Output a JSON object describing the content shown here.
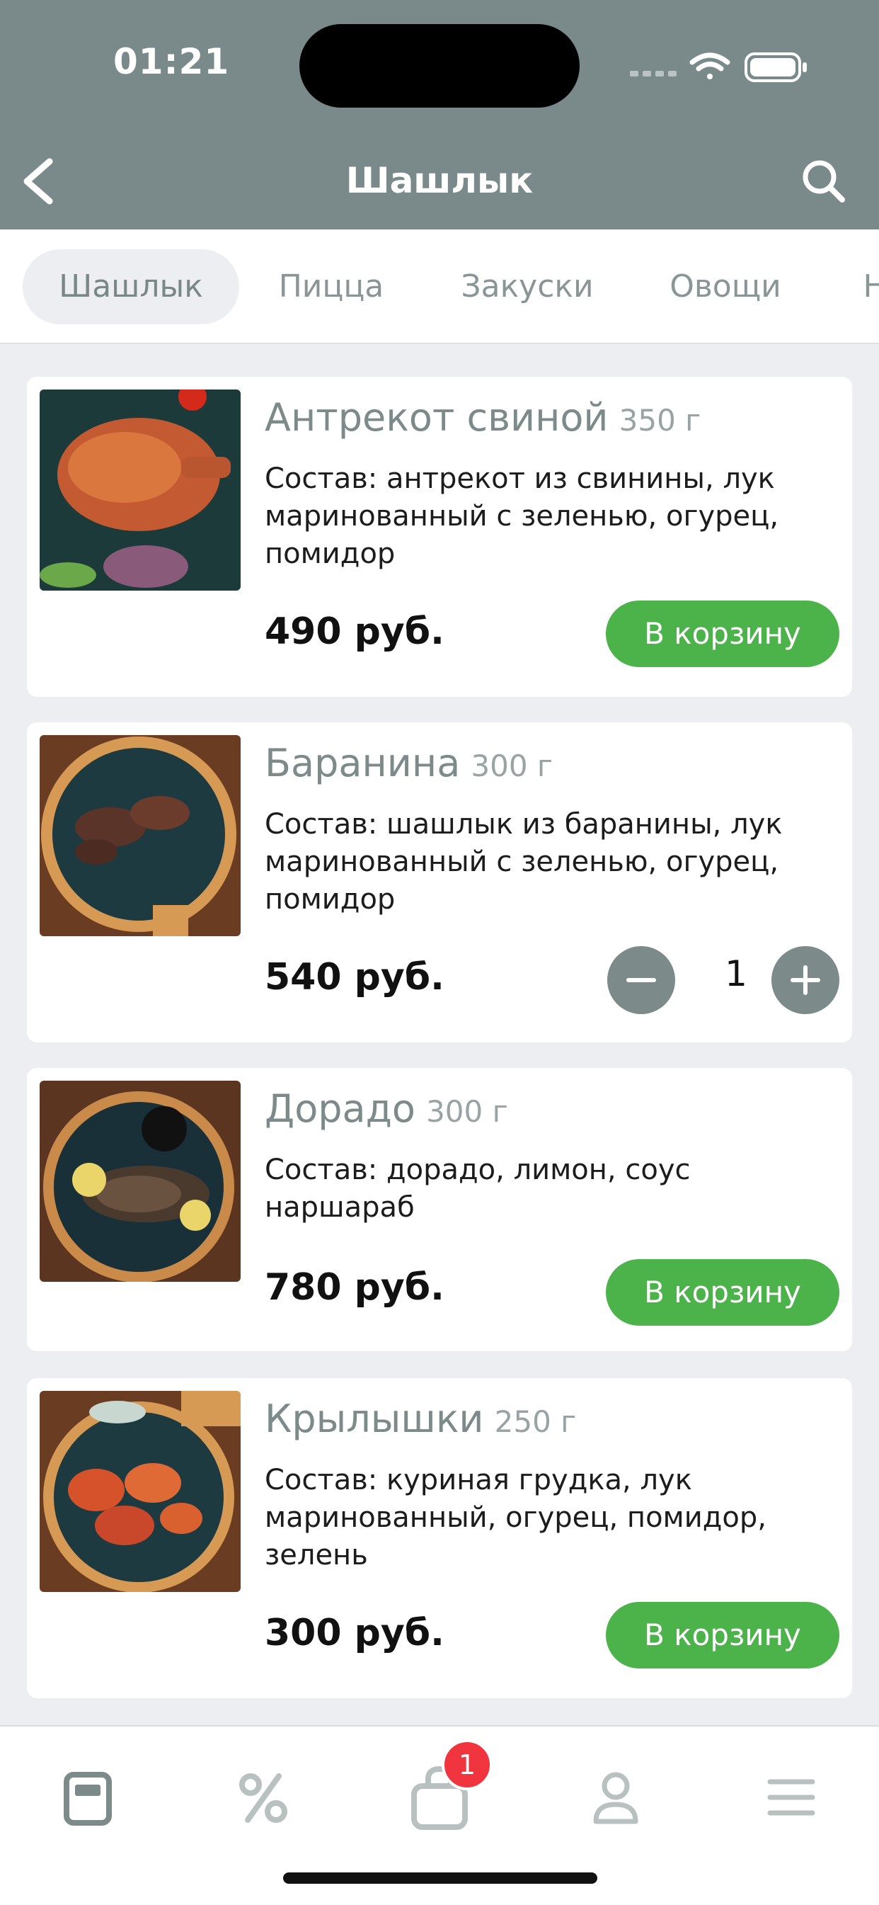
{
  "status_bar": {
    "time": "01:21"
  },
  "nav": {
    "title": "Шашлык",
    "back_icon": "chevron-left-icon",
    "search_icon": "search-icon"
  },
  "categories": [
    "Шашлык",
    "Пицца",
    "Закуски",
    "Овощи",
    "Н"
  ],
  "active_category": "Шашлык",
  "items": [
    {
      "name": "Антрекот свиной",
      "weight": "350 г",
      "description": "Состав: антрекот из свинины, лук маринованный с зеленью, огурец, помидор",
      "price": "490 руб.",
      "action": "В корзину"
    },
    {
      "name": "Баранина",
      "weight": "300 г",
      "description": "Состав: шашлык из баранины, лук маринованный с зеленью, огурец, помидор",
      "price": "540 руб.",
      "quantity": "1"
    },
    {
      "name": "Дорадо",
      "weight": "300 г",
      "description": "Состав: дорадо, лимон, соус наршараб",
      "price": "780 руб.",
      "action": "В корзину"
    },
    {
      "name": "Крылышки",
      "weight": "250 г",
      "description": "Состав: куриная грудка, лук маринованный, огурец, помидор, зелень",
      "price": "300 руб.",
      "action": "В корзину"
    }
  ],
  "tabbar": {
    "icons": [
      "menu-book-icon",
      "percent-icon",
      "shopping-bag-icon",
      "profile-icon",
      "hamburger-menu-icon"
    ],
    "cart_badge": "1"
  },
  "colors": {
    "header": "#7a8a8a",
    "accent_green": "#4cb34a",
    "badge_red": "#f0353e",
    "background": "#eceef1"
  }
}
